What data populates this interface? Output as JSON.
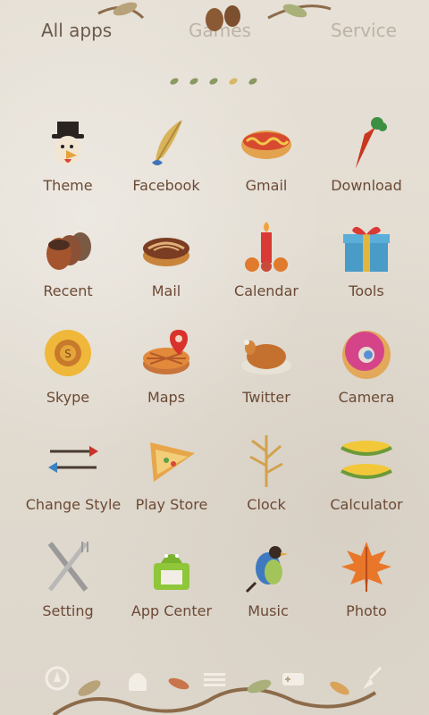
{
  "tabs": [
    {
      "label": "All apps",
      "active": true
    },
    {
      "label": "Games",
      "active": false
    },
    {
      "label": "Service",
      "active": false
    }
  ],
  "page_indicator": {
    "count": 5,
    "active_index": 3
  },
  "apps": [
    {
      "label": "Theme",
      "icon": "turkey-icon"
    },
    {
      "label": "Facebook",
      "icon": "feather-icon"
    },
    {
      "label": "Gmail",
      "icon": "hotdog-icon"
    },
    {
      "label": "Download",
      "icon": "carrot-icon"
    },
    {
      "label": "Recent",
      "icon": "chestnut-icon"
    },
    {
      "label": "Mail",
      "icon": "pie-icon"
    },
    {
      "label": "Calendar",
      "icon": "candle-icon"
    },
    {
      "label": "Tools",
      "icon": "giftbox-icon"
    },
    {
      "label": "Skype",
      "icon": "sunflower-icon"
    },
    {
      "label": "Maps",
      "icon": "pie-pin-icon"
    },
    {
      "label": "Twitter",
      "icon": "roast-turkey-icon"
    },
    {
      "label": "Camera",
      "icon": "donut-icon"
    },
    {
      "label": "Change Style",
      "icon": "arrows-icon"
    },
    {
      "label": "Play Store",
      "icon": "pie-slice-icon"
    },
    {
      "label": "Clock",
      "icon": "wheat-icon"
    },
    {
      "label": "Calculator",
      "icon": "corn-icon"
    },
    {
      "label": "Setting",
      "icon": "fork-knife-icon"
    },
    {
      "label": "App Center",
      "icon": "android-basket-icon"
    },
    {
      "label": "Music",
      "icon": "bird-icon"
    },
    {
      "label": "Photo",
      "icon": "maple-leaf-icon"
    }
  ],
  "dock": [
    {
      "icon": "compass-icon"
    },
    {
      "icon": "android-icon"
    },
    {
      "icon": "app-drawer-icon"
    },
    {
      "icon": "gamepad-icon"
    },
    {
      "icon": "broom-icon"
    }
  ]
}
